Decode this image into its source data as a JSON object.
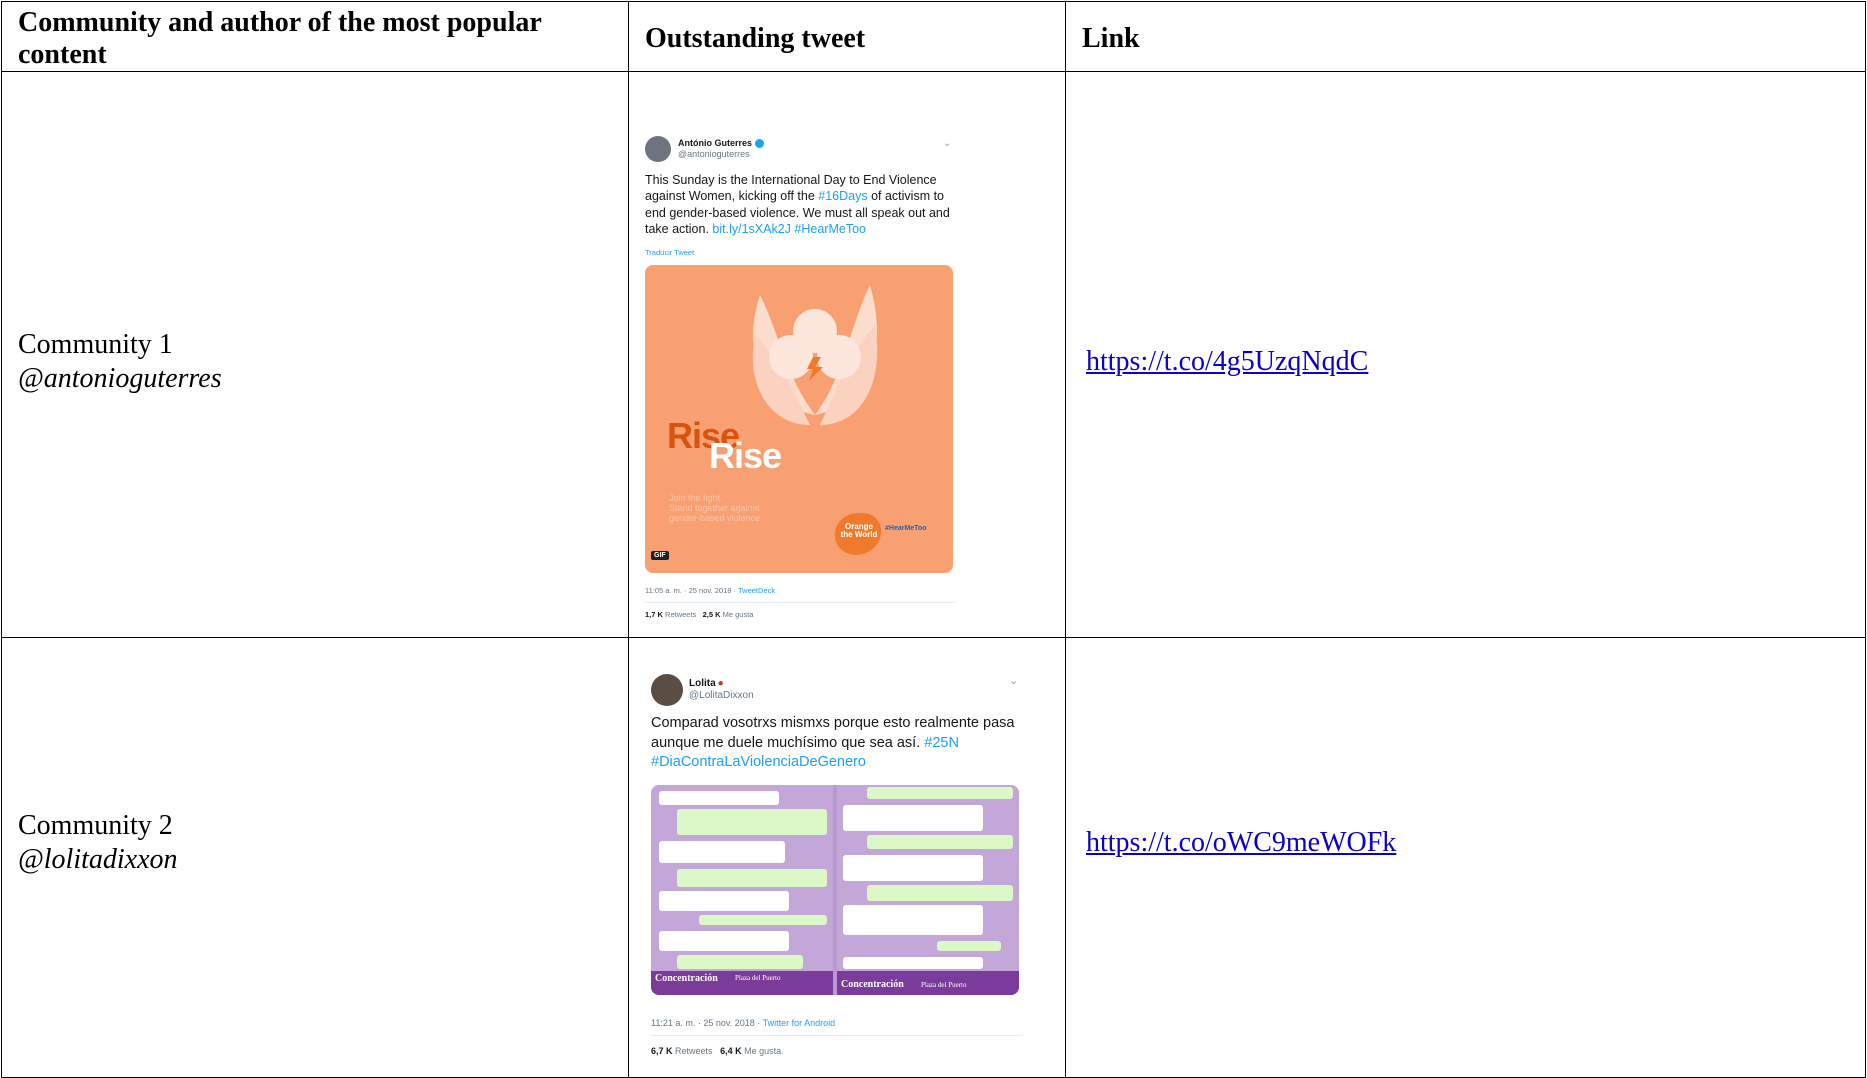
{
  "table": {
    "headers": [
      "Community and author of the most popular content",
      "Outstanding tweet",
      "Link"
    ],
    "rows": [
      {
        "community": "Community 1",
        "handle": "@antonioguterres",
        "link": "https://t.co/4g5UzqNqdC",
        "tweet": {
          "name": "António Guterres",
          "handle": "@antonioguterres",
          "text_before": "This Sunday is the International Day to End Violence against Women, kicking off the ",
          "tag1": "#16Days",
          "text_mid": " of activism to end gender-based violence. We must all speak out and take action. ",
          "link": "bit.ly/1sXAk2J",
          "tag2": "#HearMeToo",
          "translate": "Traducir Tweet",
          "media_title1": "Rise",
          "media_title2": "Rise",
          "media_sub": "Join the fight.\nStand together against\ngender-based violence",
          "media_badge": "GIF",
          "media_logo": "Orange the World",
          "media_tag": "#HearMeToo",
          "time": "11:05 a. m. · 25 nov. 2018 · ",
          "source": "TweetDeck",
          "retweets_count": "1,7 K",
          "retweets_label": "Retweets",
          "likes_count": "2,5 K",
          "likes_label": "Me gusta"
        }
      },
      {
        "community": "Community 2",
        "handle": "@lolitadixxon",
        "link": "https://t.co/oWC9meWOFk",
        "tweet": {
          "name": "Lolita",
          "handle": "@LolitaDixxon",
          "text": "Comparad vosotrxs mismxs porque esto realmente pasa aunque me duele muchísimo que sea así. ",
          "tag1": "#25N",
          "tag2": "#DiaContraLaViolenciaDeGenero",
          "banner_left": "Concentración",
          "banner_left_sub": "Plaza del Puerto",
          "banner_right": "Concentración",
          "banner_right_sub": "Plaza del Puerto",
          "time": "11:21 a. m. · 25 nov. 2018 · ",
          "source": "Twitter for Android",
          "retweets_count": "6,7 K",
          "retweets_label": "Retweets",
          "likes_count": "6,4 K",
          "likes_label": "Me gusta"
        }
      }
    ]
  },
  "colors": {
    "link": "#0b00c8",
    "twitter_blue": "#1da1f2",
    "orange": "#f9a072",
    "purple": "#7b3b9b"
  }
}
